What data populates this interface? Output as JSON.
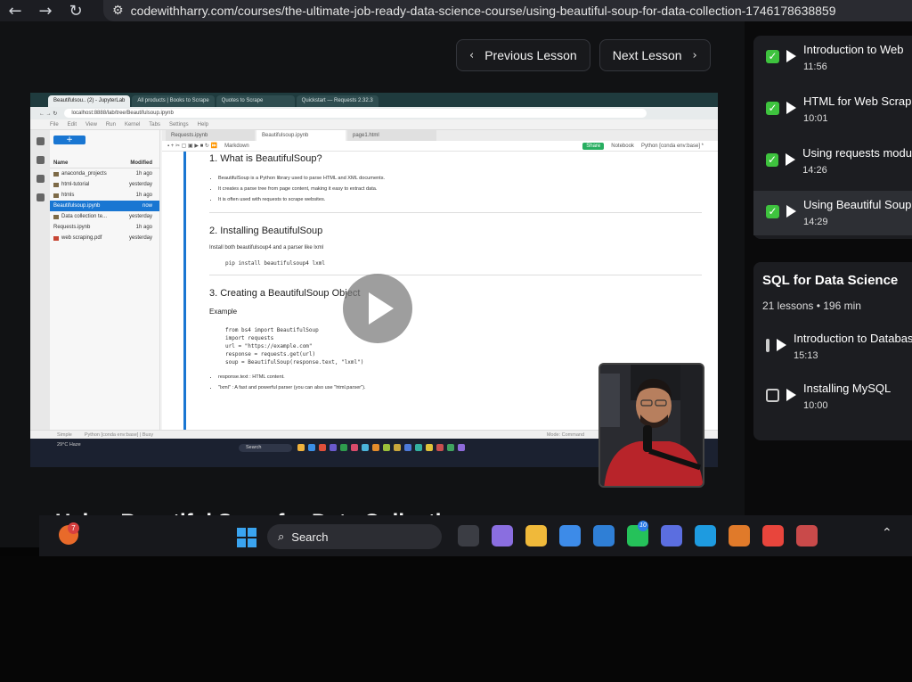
{
  "browser": {
    "url": "codewithharry.com/courses/the-ultimate-job-ready-data-science-course/using-beautiful-soup-for-data-collection-1746178638859"
  },
  "lesson_nav": {
    "previous_label": "Previous Lesson",
    "next_label": "Next Lesson"
  },
  "video": {
    "title": "Using Beautiful Soup for Data Collection",
    "tabs": [
      "Beautifulsou.. (2) - JupyterLab",
      "All products | Books to Scrape",
      "Quotes to Scrape",
      "Quickstart — Requests 2.32.3"
    ],
    "address": "localhost:8888/lab/tree/Beautifulsoup.ipynb",
    "menu": [
      "File",
      "Edit",
      "View",
      "Run",
      "Kernel",
      "Tabs",
      "Settings",
      "Help"
    ],
    "file_header": {
      "name": "Name",
      "modified": "Modified"
    },
    "files": [
      {
        "name": "anaconda_projects",
        "modified": "1h ago"
      },
      {
        "name": "html-tutorial",
        "modified": "yesterday"
      },
      {
        "name": "htmls",
        "modified": "1h ago"
      },
      {
        "name": "Beautifulsoup.ipynb",
        "modified": "now"
      },
      {
        "name": "Data collection te...",
        "modified": "yesterday"
      },
      {
        "name": "Requests.ipynb",
        "modified": "1h ago"
      },
      {
        "name": "web scraping.pdf",
        "modified": "yesterday"
      }
    ],
    "nb_tabs": [
      "Requests.ipynb",
      "Beautifulsoup.ipynb",
      "page1.html"
    ],
    "cell_type": "Markdown",
    "share": "Share",
    "notebook": "Notebook",
    "kernel": "Python [conda env:base] *",
    "h1": "1. What is BeautifulSoup?",
    "bullets": [
      "BeautifulSoup is a Python library used to parse HTML and XML documents.",
      "It creates a parse tree from page content, making it easy to extract data.",
      "It is often used with requests to scrape websites."
    ],
    "h2": "2. Installing BeautifulSoup",
    "install_text": "Install both beautifulsoup4 and a parser like lxml",
    "install_cmd": "pip install beautifulsoup4 lxml",
    "h3": "3. Creating a BeautifulSoup Object",
    "example": "Example",
    "code_lines": [
      "from bs4 import BeautifulSoup",
      "import requests",
      "",
      "url = \"https://example.com\"",
      "response = requests.get(url)",
      "",
      "soup = BeautifulSoup(response.text, \"lxml\")"
    ],
    "notes": [
      "response.text : HTML content.",
      "\"lxml\" : A fast and powerful parser (you can also use \"html.parser\")."
    ],
    "status_left": "Simple",
    "status_mid": "Python [conda env:base] | Busy",
    "status_right": "Mode: Command",
    "weather": "29°C Haze",
    "search": "Search"
  },
  "sidebar": {
    "lessons": [
      {
        "title": "Introduction to Web",
        "time": "11:56",
        "done": true
      },
      {
        "title": "HTML for Web Scrap",
        "time": "10:01",
        "done": true
      },
      {
        "title": "Using requests modu",
        "time": "14:26",
        "done": true
      },
      {
        "title": "Using Beautiful Soup",
        "time": "14:29",
        "done": true,
        "active": true
      }
    ],
    "section": {
      "title": "SQL for Data Science",
      "meta": "21 lessons • 196 min",
      "lessons": [
        {
          "title": "Introduction to Databas",
          "time": "15:13",
          "done": false
        },
        {
          "title": "Installing MySQL",
          "time": "10:00",
          "done": false
        }
      ]
    }
  },
  "taskbar": {
    "search": "Search",
    "badge_left": "7",
    "badge_whatsapp": "10"
  },
  "colors": {
    "accent_green": "#3ec33e",
    "jupyter_blue": "#1976d2"
  }
}
